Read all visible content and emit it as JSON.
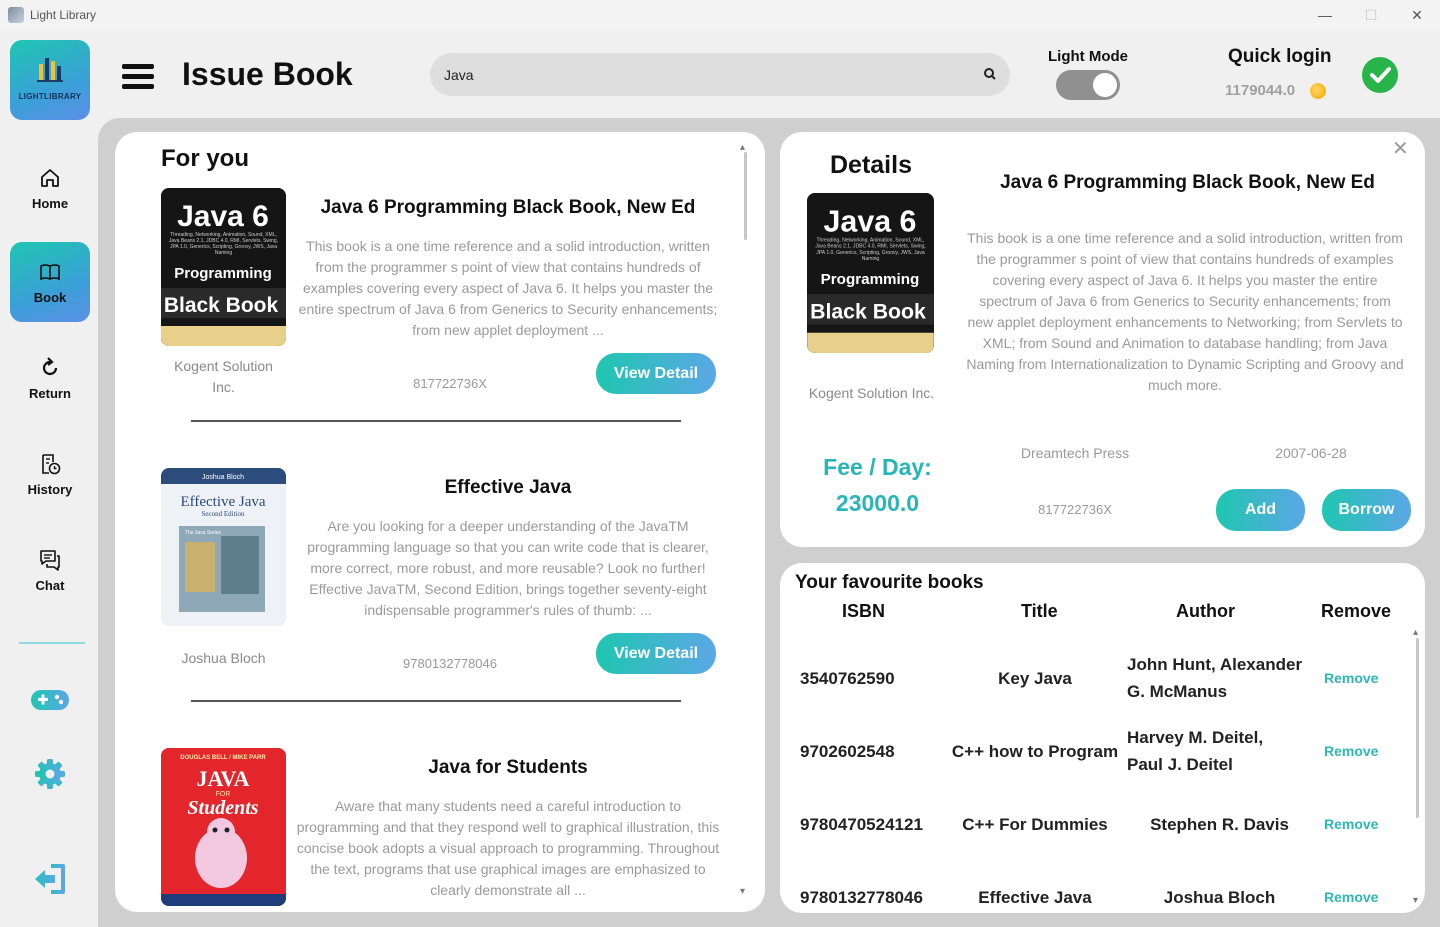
{
  "window": {
    "title": "Light Library",
    "controls": [
      "—",
      "☐",
      "✕"
    ]
  },
  "sidebar": {
    "logo_text": "LIGHTLIBRARY",
    "items": [
      {
        "label": "Home",
        "icon": "home-icon"
      },
      {
        "label": "Book",
        "icon": "book-icon",
        "active": true
      },
      {
        "label": "Return",
        "icon": "return-icon"
      },
      {
        "label": "History",
        "icon": "history-icon"
      },
      {
        "label": "Chat",
        "icon": "chat-icon"
      }
    ],
    "extra_icons": [
      "gamepad-icon",
      "settings-gear-icon",
      "logout-icon"
    ]
  },
  "header": {
    "title": "Issue Book",
    "search_value": "Java",
    "light_mode_label": "Light Mode",
    "quick_login_label": "Quick login",
    "balance": "1179044.0"
  },
  "foryou": {
    "heading": "For you",
    "items": [
      {
        "title": "Java 6 Programming Black Book, New Ed",
        "description": "This book is a one time reference and a solid introduction, written from the programmer s point of view that contains hundreds of examples covering every aspect of Java 6. It helps you master the entire spectrum of Java 6 from Generics to Security enhancements; from new applet deployment ...",
        "author": "Kogent Solution Inc.",
        "isbn": "817722736X",
        "button": "View Detail"
      },
      {
        "title": "Effective Java",
        "description": "Are you looking for a deeper understanding of the JavaTM programming language so that you can write code that is clearer, more correct, more robust, and more reusable? Look no further! Effective JavaTM, Second Edition, brings together seventy-eight indispensable programmer's rules of thumb: ...",
        "author": "Joshua Bloch",
        "isbn": "9780132778046",
        "button": "View Detail"
      },
      {
        "title": "Java for Students",
        "description": "Aware that many students need a careful introduction to programming and that they respond well to graphical illustration, this concise book adopts a visual approach to programming. Throughout the text, programs that use graphical images are emphasized to clearly demonstrate all ..."
      }
    ],
    "covers": {
      "java6": {
        "title": "Java 6",
        "subtitle": "Threading, Networking, Animation, Sound, XML, Java Beans 2.1, JDBC 4.0, RMI, Servlets, Swing, JPA 1.0, Generics, Scripting, Groovy, JWS, Java Naming",
        "mid": "Programming",
        "bottom": "Black Book"
      },
      "effective": {
        "author": "Joshua Bloch",
        "title": "Effective Java",
        "edition": "Second Edition",
        "series": "The Java Series"
      },
      "students": {
        "authors": "DOUGLAS BELL / MIKE PARR",
        "title": "JAVA",
        "for": "FOR",
        "subtitle": "Students"
      }
    }
  },
  "details": {
    "heading": "Details",
    "title": "Java 6 Programming Black Book, New Ed",
    "description": "This book is a one time reference and a solid introduction, written from the programmer s point of view that contains hundreds of examples covering every aspect of Java 6. It helps you master the entire spectrum of Java 6 from Generics to Security enhancements; from new applet deployment enhancements to Networking; from Servlets to XML; from Sound and Animation to database handling; from Java Naming from Internationalization to Dynamic Scripting and Groovy and much more.",
    "author": "Kogent Solution Inc.",
    "publisher": "Dreamtech Press",
    "date": "2007-06-28",
    "isbn": "817722736X",
    "fee_label": "Fee / Day:",
    "fee_value": "23000.0",
    "add_button": "Add",
    "borrow_button": "Borrow",
    "close": "✕"
  },
  "favourites": {
    "heading": "Your favourite books",
    "columns": [
      "ISBN",
      "Title",
      "Author",
      "Remove"
    ],
    "rows": [
      {
        "isbn": "3540762590",
        "title": "Key Java",
        "author": "John Hunt, Alexander G. McManus",
        "remove": "Remove"
      },
      {
        "isbn": "9702602548",
        "title": "C++ how to Program",
        "author": "Harvey M. Deitel, Paul J. Deitel",
        "remove": "Remove"
      },
      {
        "isbn": "9780470524121",
        "title": "C++ For Dummies",
        "author": "Stephen R. Davis",
        "remove": "Remove"
      },
      {
        "isbn": "9780132778046",
        "title": "Effective Java",
        "author": "Joshua Bloch",
        "remove": "Remove"
      }
    ]
  },
  "colors": {
    "accent_start": "#1fc6b0",
    "accent_end": "#5ba7e6",
    "fee": "#27b6b8",
    "check": "#27b54a"
  }
}
